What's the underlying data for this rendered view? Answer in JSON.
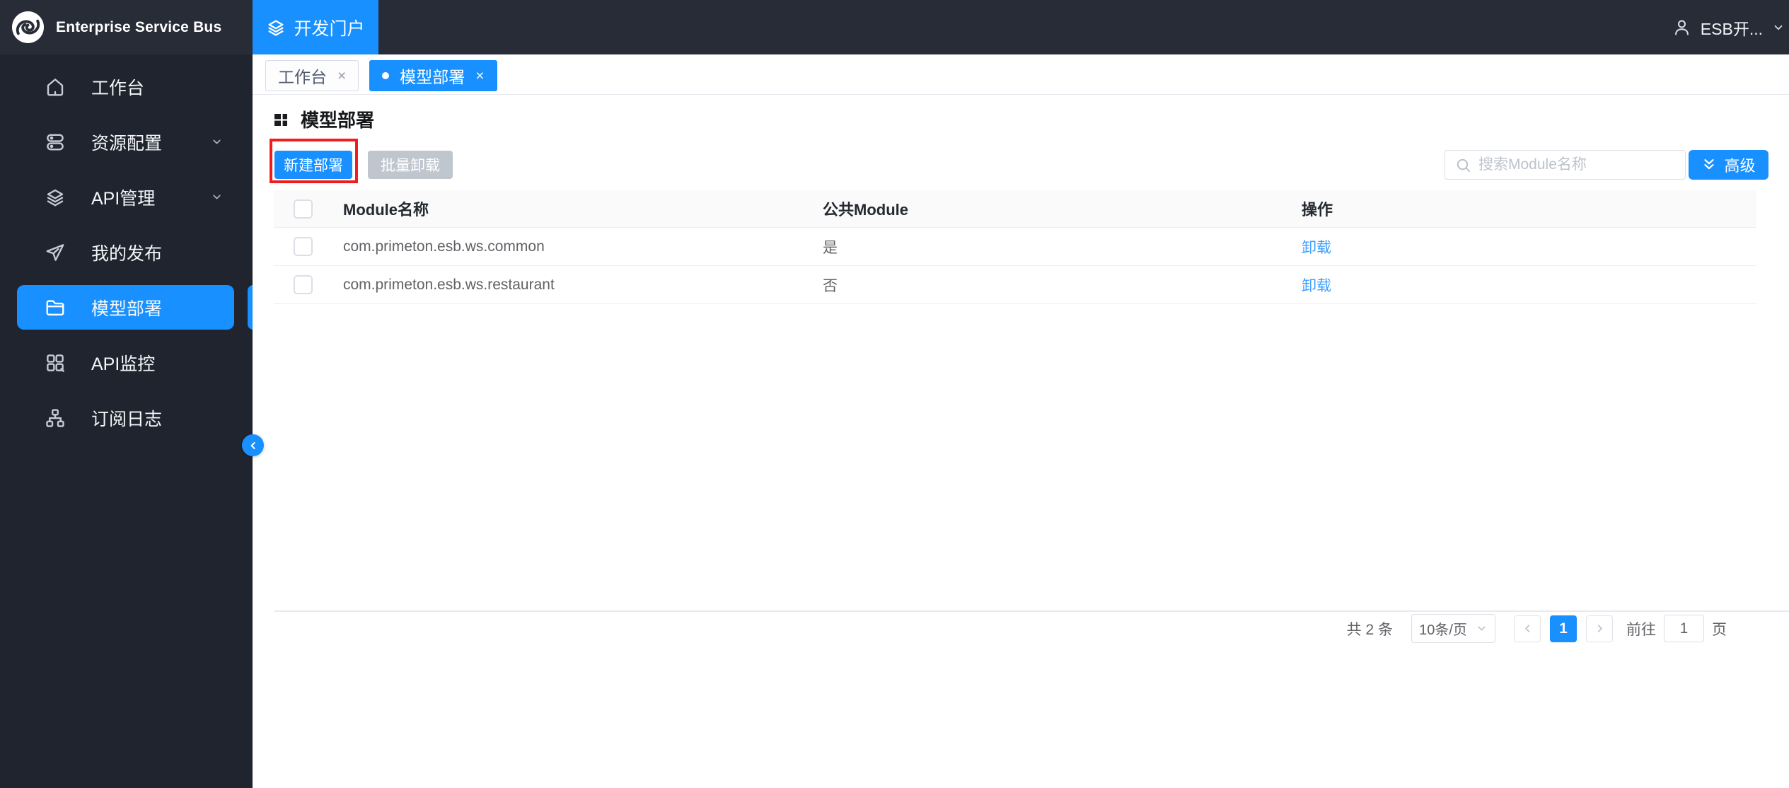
{
  "app": {
    "brand": "Enterprise Service Bus",
    "portal_tab": "开发门户",
    "user_name": "ESB开..."
  },
  "sidebar": {
    "items": [
      {
        "label": "工作台",
        "icon": "home-icon",
        "active": false,
        "expandable": false
      },
      {
        "label": "资源配置",
        "icon": "server-icon",
        "active": false,
        "expandable": true
      },
      {
        "label": "API管理",
        "icon": "layers-icon",
        "active": false,
        "expandable": true
      },
      {
        "label": "我的发布",
        "icon": "send-icon",
        "active": false,
        "expandable": false
      },
      {
        "label": "模型部署",
        "icon": "folder-icon",
        "active": true,
        "expandable": false
      },
      {
        "label": "API监控",
        "icon": "monitor-grid-icon",
        "active": false,
        "expandable": false
      },
      {
        "label": "订阅日志",
        "icon": "sitemap-icon",
        "active": false,
        "expandable": false
      }
    ]
  },
  "tabs": [
    {
      "label": "工作台",
      "active": false
    },
    {
      "label": "模型部署",
      "active": true
    }
  ],
  "page": {
    "title": "模型部署"
  },
  "toolbar": {
    "new_button": "新建部署",
    "batch_button": "批量卸载",
    "search_placeholder": "搜索Module名称",
    "advanced_button": "高级"
  },
  "table": {
    "headers": {
      "name": "Module名称",
      "public": "公共Module",
      "action": "操作"
    },
    "rows": [
      {
        "name": "com.primeton.esb.ws.common",
        "public": "是",
        "action": "卸载"
      },
      {
        "name": "com.primeton.esb.ws.restaurant",
        "public": "否",
        "action": "卸载"
      }
    ]
  },
  "pagination": {
    "total": "共 2 条",
    "page_size": "10条/页",
    "current_page": "1",
    "goto_label": "前往",
    "goto_value": "1",
    "unit_label": "页"
  },
  "colors": {
    "primary": "#1890ff",
    "link": "#409eff",
    "topbar_bg": "#272c37",
    "sidebar_bg": "#20242e",
    "annotation_red": "#f21c1c"
  }
}
